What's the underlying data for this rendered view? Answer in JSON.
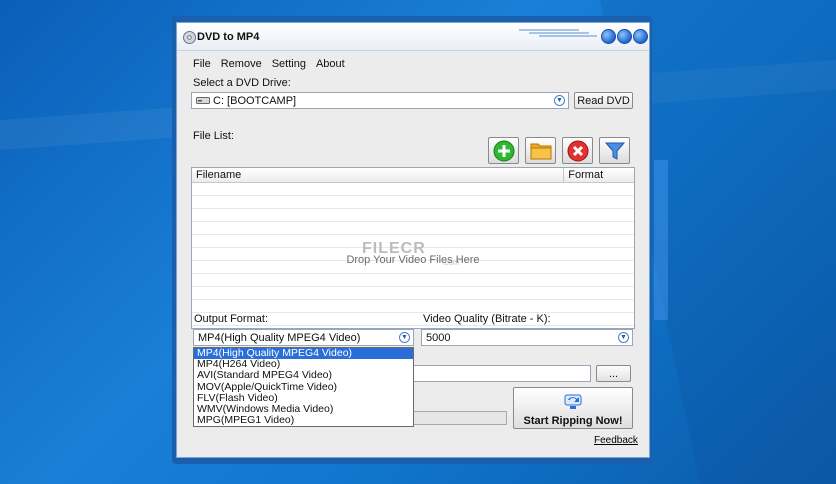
{
  "window": {
    "title": "DVD to MP4"
  },
  "menu": {
    "items": [
      "File",
      "Remove",
      "Setting",
      "About"
    ]
  },
  "drive": {
    "label": "Select a DVD Drive:",
    "selected": "C: [BOOTCAMP]",
    "read_button": "Read DVD"
  },
  "file_list": {
    "label": "File List:",
    "columns": [
      "Filename",
      "Format"
    ],
    "drop_hint": "Drop Your Video Files Here",
    "watermark": "FILECR",
    "watermark_sub": ".com"
  },
  "toolbar": {
    "icons": [
      "add-icon",
      "folder-icon",
      "delete-icon",
      "filter-icon"
    ]
  },
  "output_format": {
    "label": "Output Format:",
    "selected": "MP4(High Quality MPEG4 Video)",
    "options": [
      "MP4(High Quality MPEG4 Video)",
      "MP4(H264 Video)",
      "AVI(Standard MPEG4 Video)",
      "MOV(Apple/QuickTime Video)",
      "FLV(Flash Video)",
      "WMV(Windows Media Video)",
      "MPG(MPEG1 Video)"
    ],
    "highlighted_index": 0
  },
  "video_quality": {
    "label": "Video Quality (Bitrate - K):",
    "selected": "5000"
  },
  "output_folder": {
    "value": "",
    "browse_label": "..."
  },
  "rip": {
    "label": "Start Ripping Now!"
  },
  "progress": {
    "fraction": 0
  },
  "feedback": {
    "label": "Feedback"
  },
  "colors": {
    "accent": "#2a6fd9",
    "desktop": "#1078d0",
    "titlebar_ctrl": "#1f66d1"
  }
}
